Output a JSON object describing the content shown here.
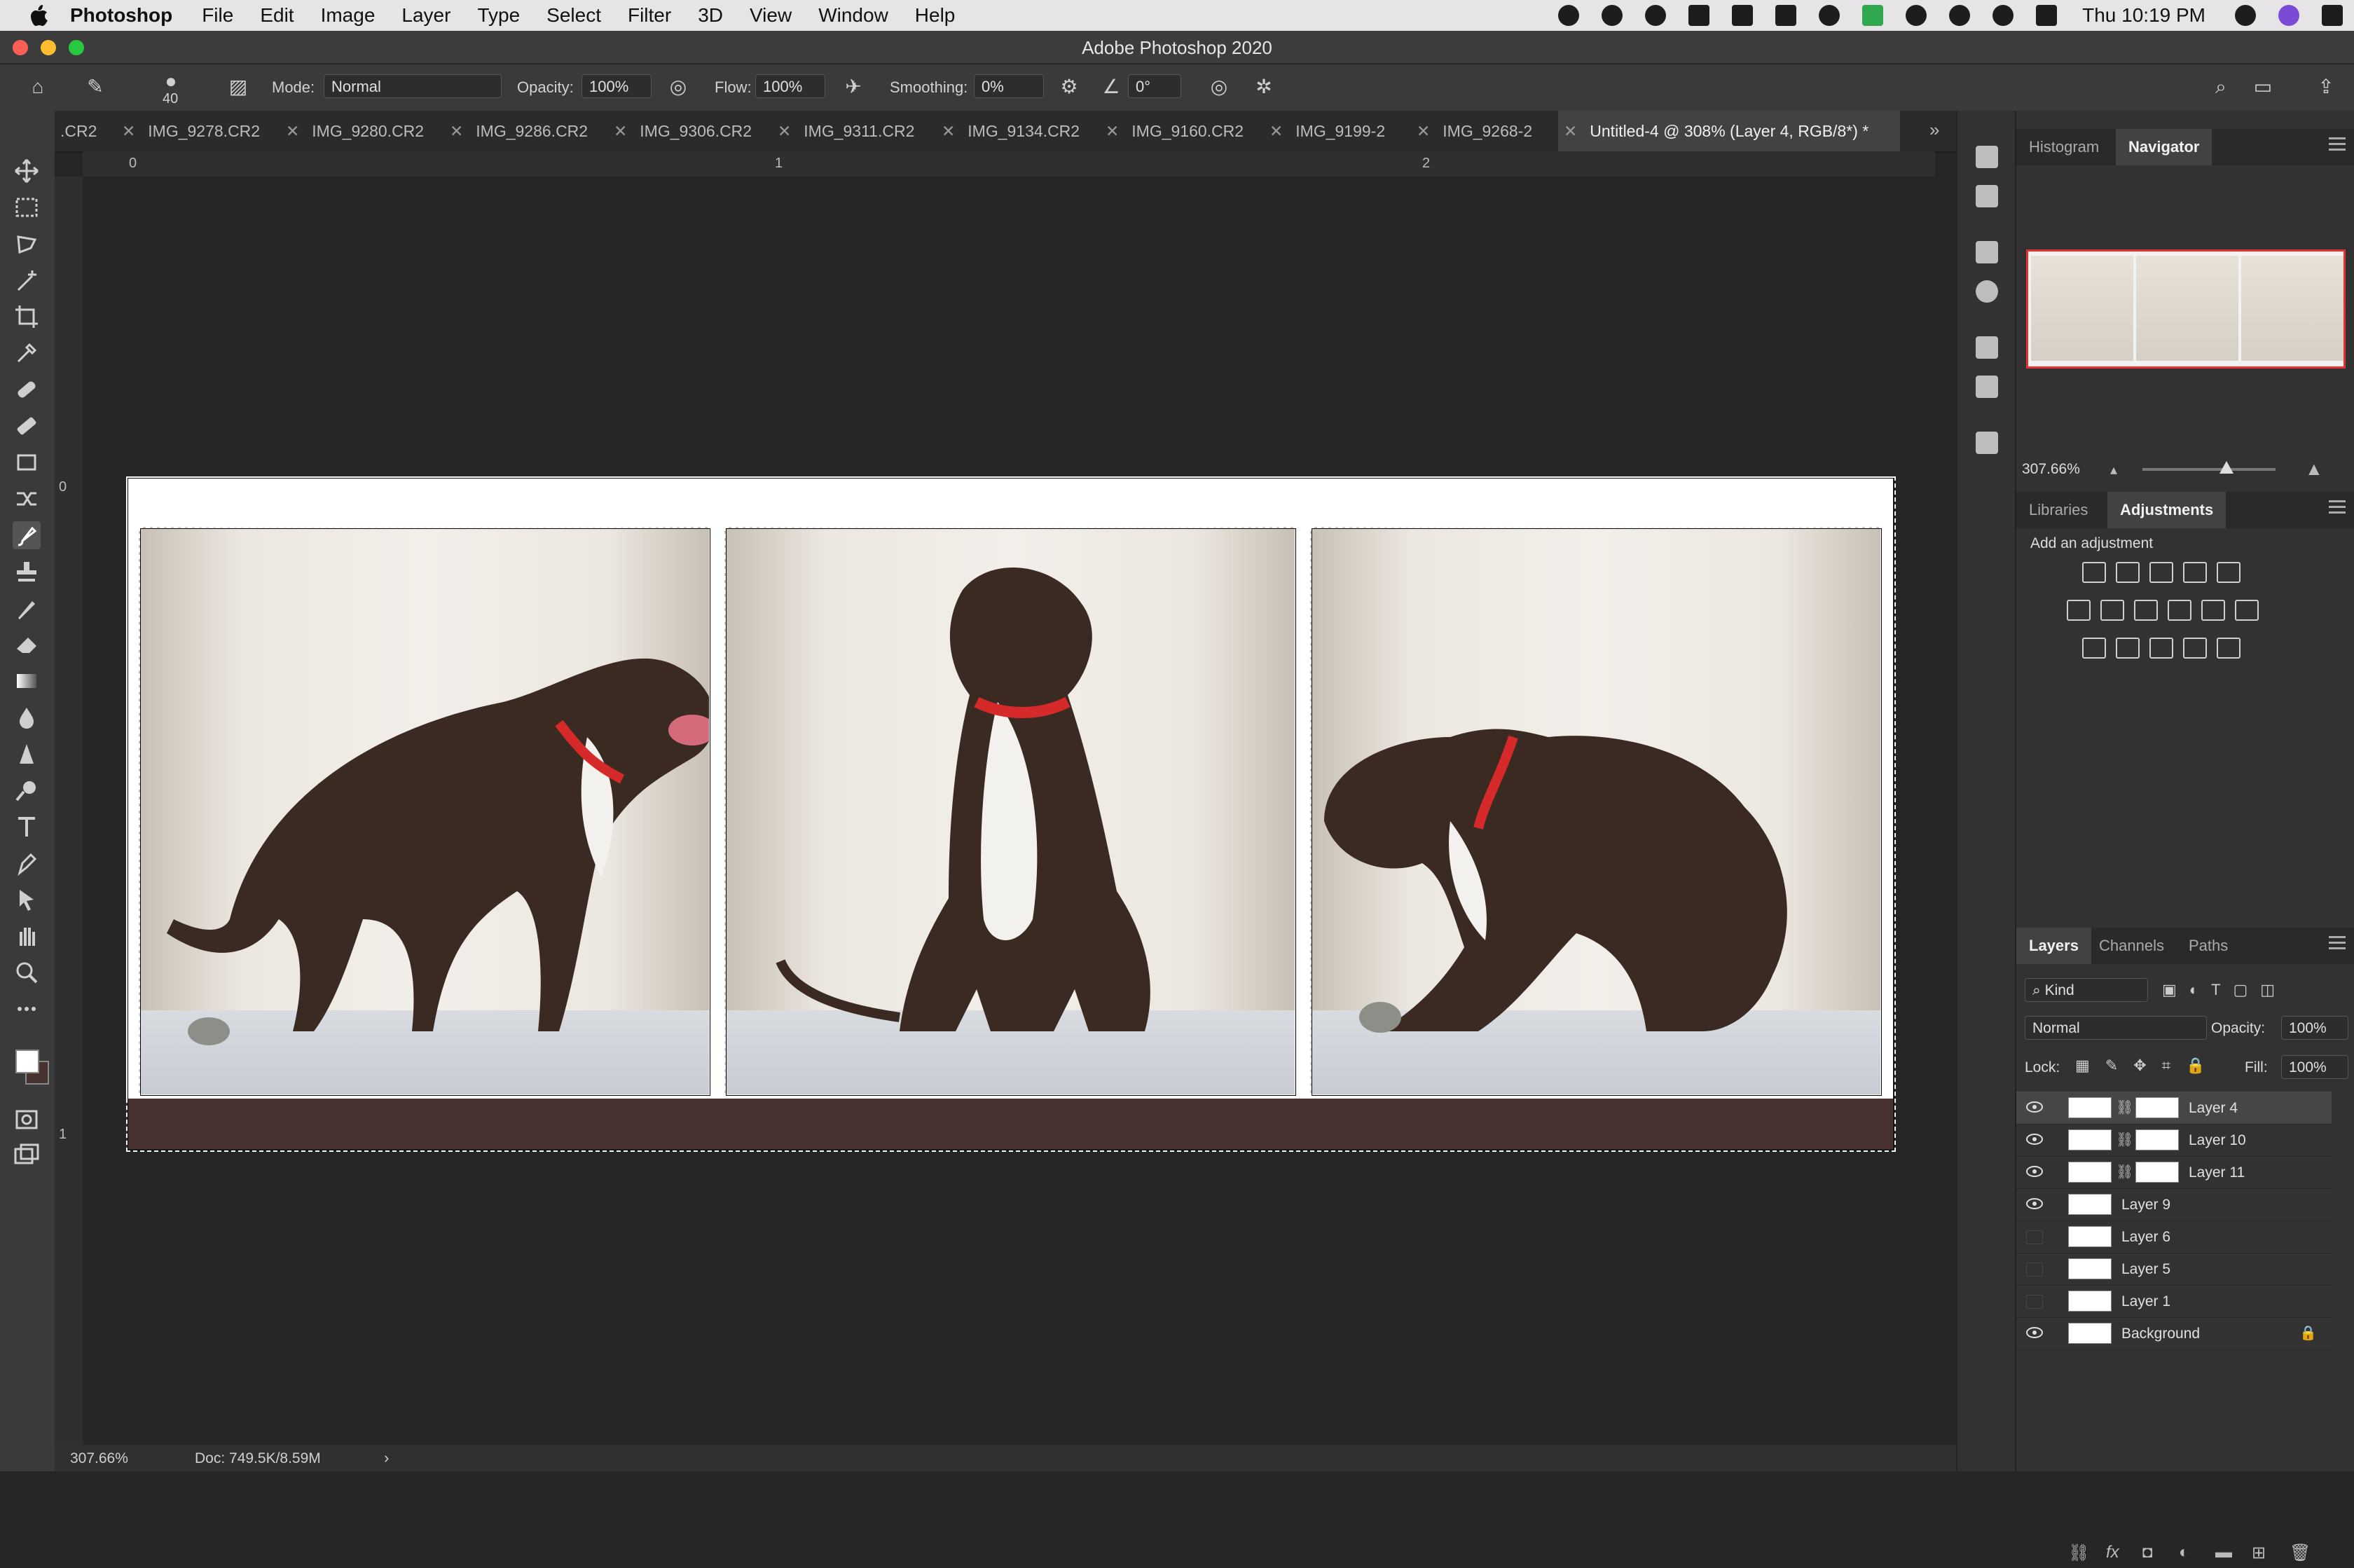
{
  "menubar": {
    "app": "Photoshop",
    "items": [
      "File",
      "Edit",
      "Image",
      "Layer",
      "Type",
      "Select",
      "Filter",
      "3D",
      "View",
      "Window",
      "Help"
    ],
    "clock": "Thu 10:19 PM"
  },
  "window": {
    "title": "Adobe Photoshop 2020"
  },
  "options": {
    "brush_size": "40",
    "mode_label": "Mode:",
    "mode_value": "Normal",
    "opacity_label": "Opacity:",
    "opacity_value": "100%",
    "flow_label": "Flow:",
    "flow_value": "100%",
    "smoothing_label": "Smoothing:",
    "smoothing_value": "0%",
    "angle_value": "0°"
  },
  "tabs": [
    {
      "label": ".CR2"
    },
    {
      "label": "IMG_9278.CR2"
    },
    {
      "label": "IMG_9280.CR2"
    },
    {
      "label": "IMG_9286.CR2"
    },
    {
      "label": "IMG_9306.CR2"
    },
    {
      "label": "IMG_9311.CR2"
    },
    {
      "label": "IMG_9134.CR2"
    },
    {
      "label": "IMG_9160.CR2"
    },
    {
      "label": "IMG_9199-2"
    },
    {
      "label": "IMG_9268-2"
    },
    {
      "label": "Untitled-4 @ 308% (Layer 4, RGB/8*) *",
      "active": true
    }
  ],
  "ruler": {
    "top": [
      "0",
      "1",
      "2"
    ],
    "left": [
      "0",
      "1"
    ]
  },
  "status": {
    "zoom": "307.66%",
    "doc": "Doc: 749.5K/8.59M"
  },
  "navigator_panel": {
    "tabs": [
      "Histogram",
      "Navigator"
    ],
    "zoom": "307.66%"
  },
  "adjustments_panel": {
    "tabs": [
      "Libraries",
      "Adjustments"
    ],
    "hint": "Add an adjustment"
  },
  "layers_panel": {
    "tabs": [
      "Layers",
      "Channels",
      "Paths"
    ],
    "filter": "Kind",
    "blend_mode": "Normal",
    "opacity_label": "Opacity:",
    "opacity_value": "100%",
    "lock_label": "Lock:",
    "fill_label": "Fill:",
    "fill_value": "100%",
    "layers": [
      {
        "name": "Layer 4",
        "visible": true,
        "selected": true
      },
      {
        "name": "Layer 10",
        "visible": true
      },
      {
        "name": "Layer 11",
        "visible": true
      },
      {
        "name": "Layer 9",
        "visible": true
      },
      {
        "name": "Layer 6",
        "visible": false
      },
      {
        "name": "Layer 5",
        "visible": false
      },
      {
        "name": "Layer 1",
        "visible": false
      },
      {
        "name": "Background",
        "visible": true,
        "locked": true
      }
    ]
  },
  "colors": {
    "band": "#47322f",
    "selection_tab": "#424242",
    "nav_frame": "#e53030"
  }
}
